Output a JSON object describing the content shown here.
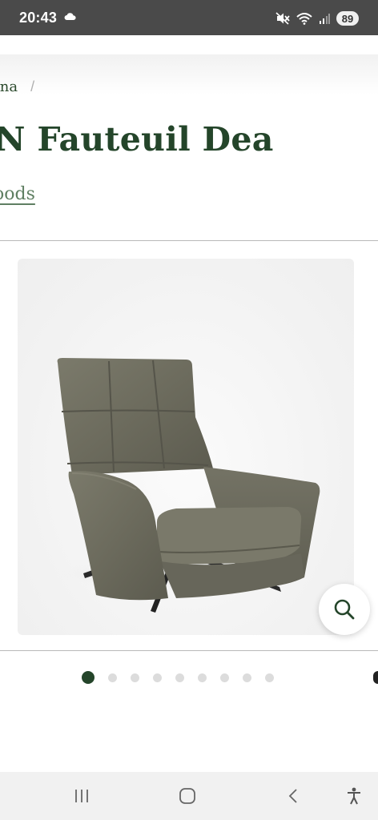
{
  "status_bar": {
    "time": "20:43",
    "battery": "89",
    "icons": [
      "cloud-icon",
      "mute-icon",
      "wifi-icon",
      "signal-icon"
    ]
  },
  "breadcrumb": {
    "current": "ina",
    "separator": "/"
  },
  "product": {
    "title": "N Fauteuil Dea",
    "brand": "oods"
  },
  "gallery": {
    "image_alt": "armchair-image",
    "total_slides": 9,
    "active_slide": 1
  },
  "search_button": {
    "icon": "search-icon"
  },
  "nav_bar": {
    "buttons": [
      "recent-apps-icon",
      "home-icon",
      "back-icon",
      "accessibility-icon"
    ]
  },
  "colors": {
    "title_green": "#24452a",
    "link_green": "#5f7f62",
    "status_bar": "#4a4a4a",
    "chair_fabric": "#6f6e60"
  }
}
